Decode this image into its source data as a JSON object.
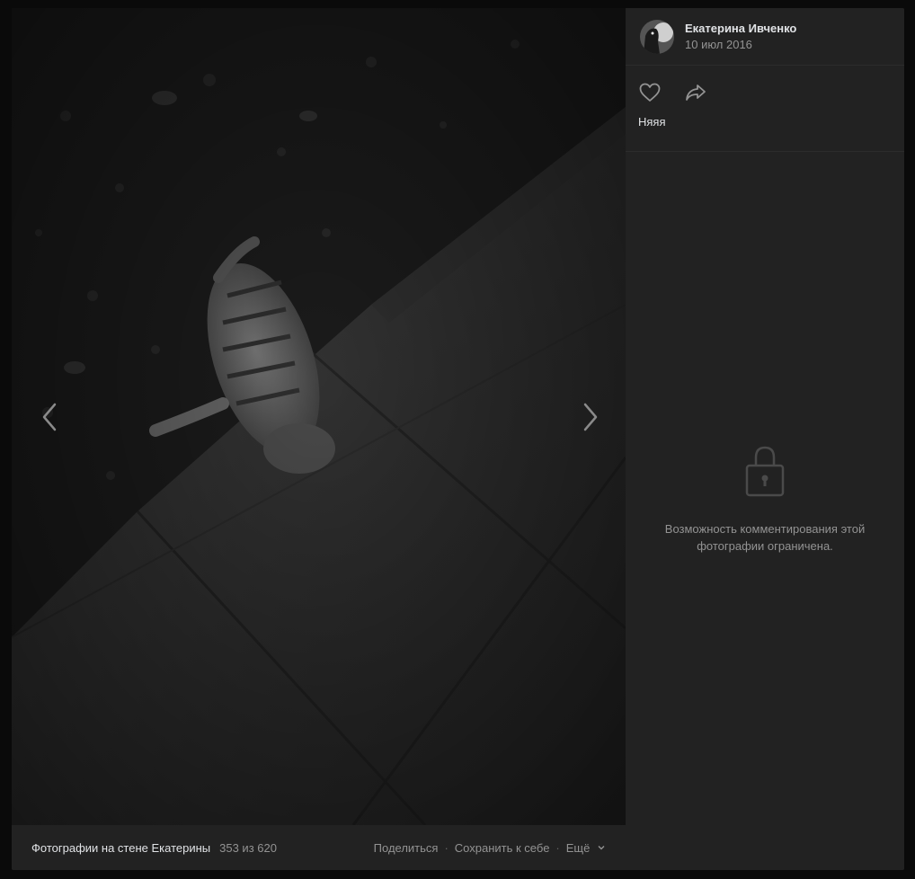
{
  "author": {
    "name": "Екатерина Ивченко",
    "date": "10 июл 2016"
  },
  "photo": {
    "caption": "Няяя",
    "comments_restricted": "Возможность комментирования этой фотографии ограничена."
  },
  "album": {
    "title": "Фотографии на стене Екатерины",
    "counter": "353 из 620"
  },
  "actions": {
    "share": "Поделиться",
    "save": "Сохранить к себе",
    "more": "Ещё"
  },
  "icons": {
    "prev": "chevron-left-icon",
    "next": "chevron-right-icon",
    "like": "heart-icon",
    "share": "share-arrow-icon",
    "lock": "lock-icon",
    "more": "chevron-down-icon"
  },
  "colors": {
    "panel_bg": "#222222",
    "text_primary": "#e1e3e6",
    "text_secondary": "#939393"
  }
}
